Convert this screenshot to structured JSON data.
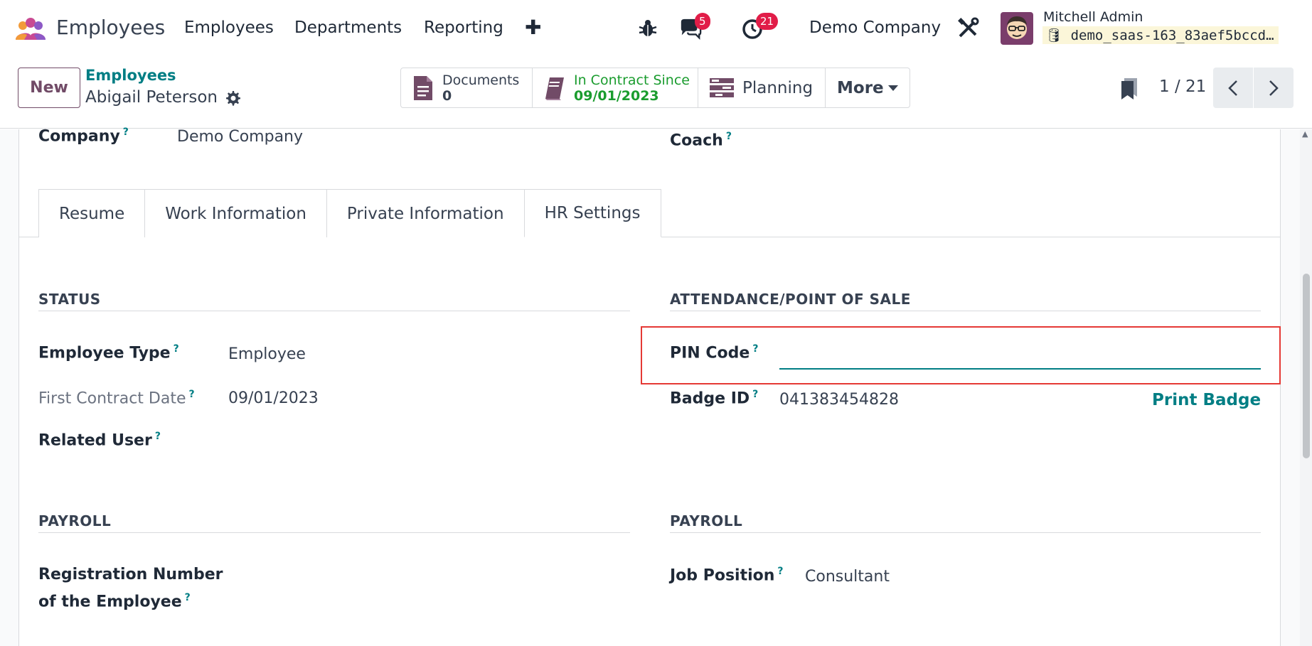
{
  "navbar": {
    "app_name": "Employees",
    "menu": [
      "Employees",
      "Departments",
      "Reporting"
    ],
    "plus": "✚",
    "messages_count": "5",
    "activities_count": "21",
    "company": "Demo Company",
    "user_name": "Mitchell Admin",
    "database": "demo_saas-163_83aef5bccd…"
  },
  "control_panel": {
    "new_label": "New",
    "breadcrumb": "Employees",
    "record_name": "Abigail Peterson",
    "smart_buttons": {
      "documents_label": "Documents",
      "documents_count": "0",
      "contract_label": "In Contract Since",
      "contract_date": "09/01/2023",
      "planning_label": "Planning",
      "more_label": "More"
    },
    "pager": "1 / 21"
  },
  "form": {
    "company_label": "Company",
    "company_value": "Demo Company",
    "coach_label": "Coach",
    "tabs": [
      "Resume",
      "Work Information",
      "Private Information",
      "HR Settings"
    ],
    "status": {
      "title": "STATUS",
      "employee_type_label": "Employee Type",
      "employee_type_value": "Employee",
      "first_contract_label": "First Contract Date",
      "first_contract_value": "09/01/2023",
      "related_user_label": "Related User"
    },
    "attendance": {
      "title": "ATTENDANCE/POINT OF SALE",
      "pin_label": "PIN Code",
      "pin_value": "",
      "badge_label": "Badge ID",
      "badge_value": "041383454828",
      "print_badge": "Print Badge"
    },
    "payroll_left": {
      "title": "PAYROLL",
      "registration_label_1": "Registration Number",
      "registration_label_2": "of the Employee"
    },
    "payroll_right": {
      "title": "PAYROLL",
      "job_position_label": "Job Position",
      "job_position_value": "Consultant"
    },
    "help_mark": "?"
  },
  "colors": {
    "brand": "#714b67",
    "teal": "#017e84",
    "green": "#1a9c2e",
    "badge": "#e11d48",
    "highlight": "#e53935"
  }
}
